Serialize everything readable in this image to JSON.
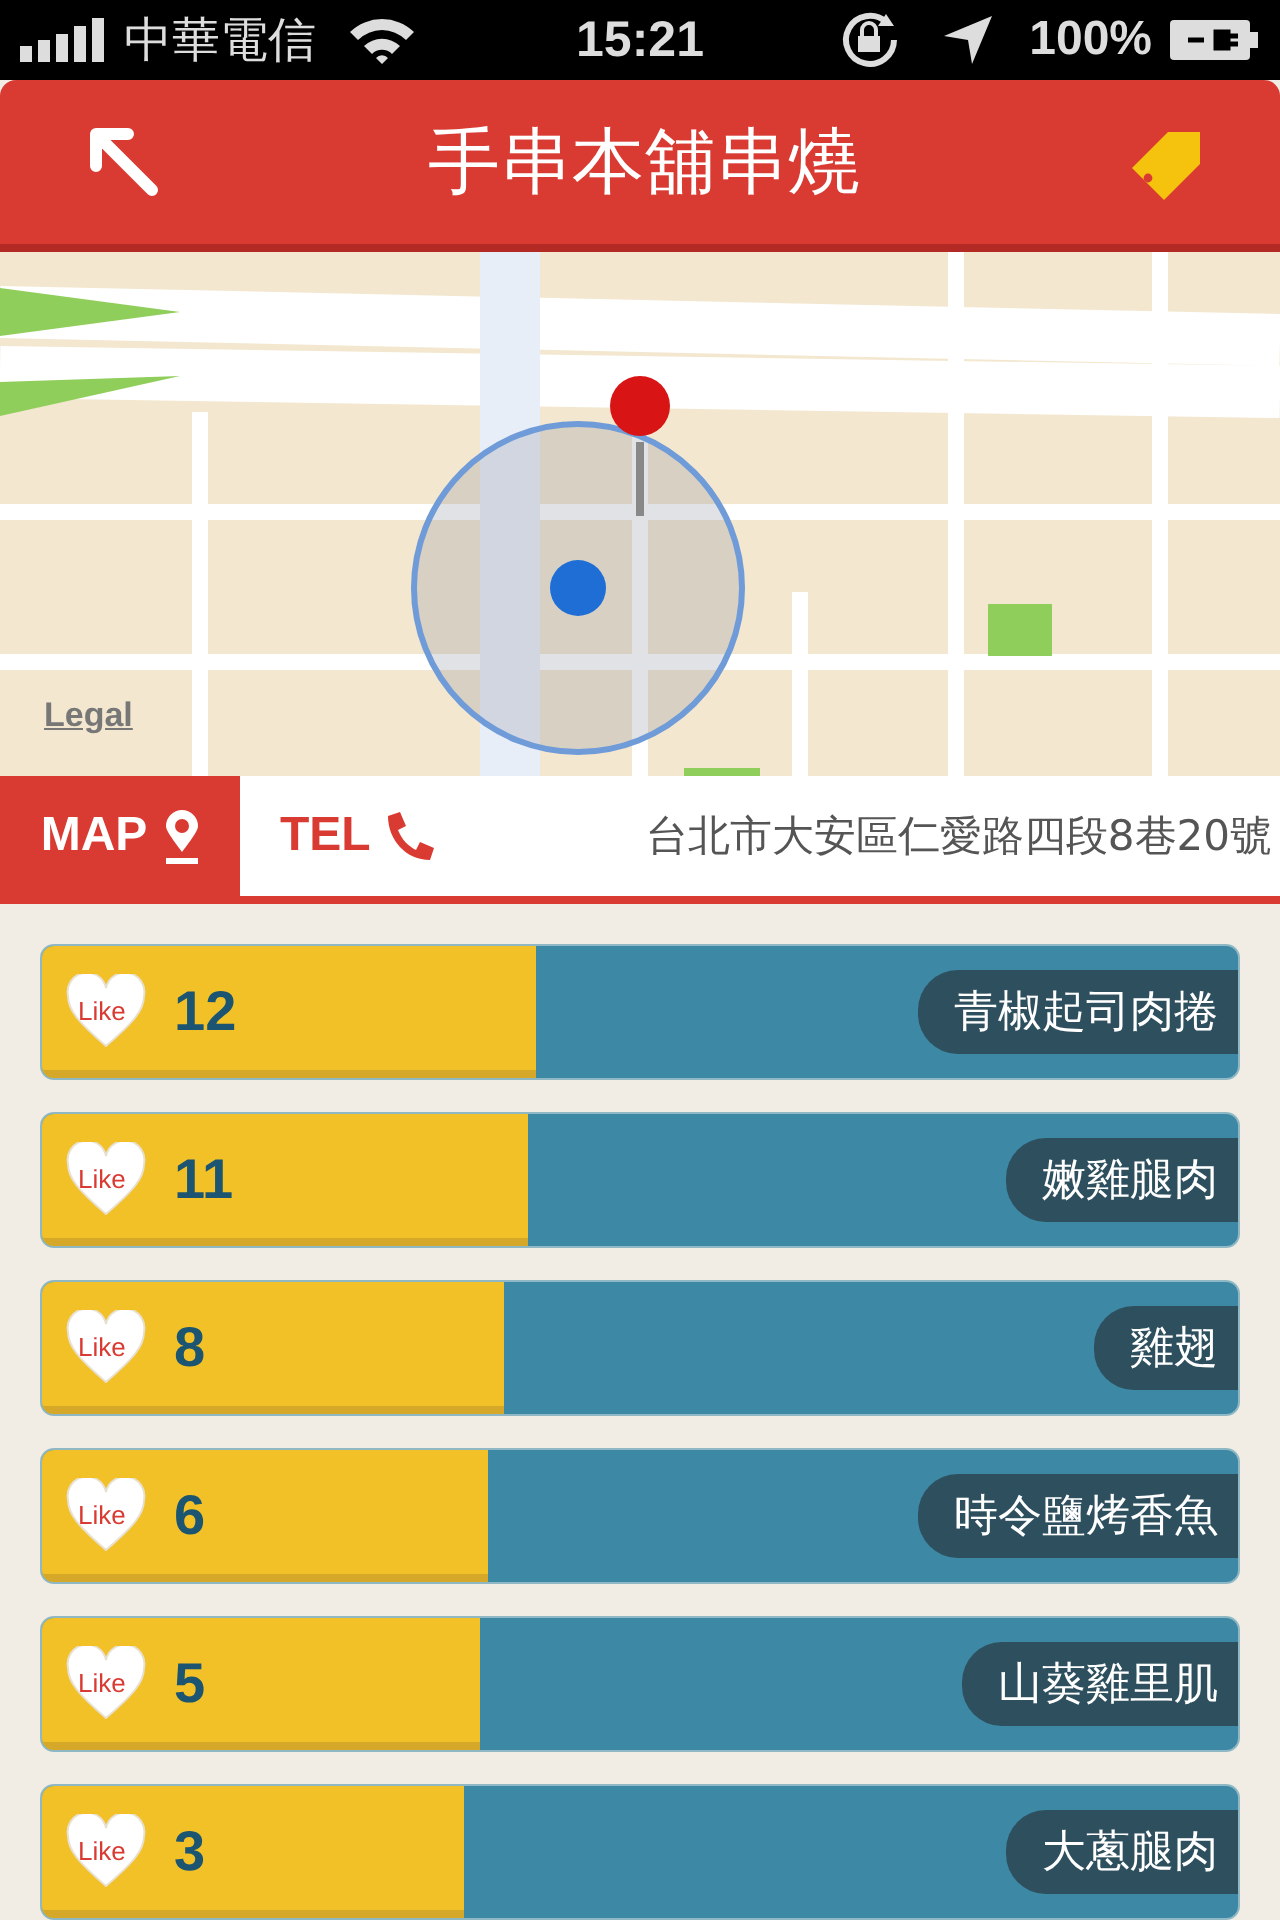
{
  "status_bar": {
    "carrier": "中華電信",
    "time": "15:21",
    "battery": "100%"
  },
  "header": {
    "title": "手串本舖串燒"
  },
  "map": {
    "legal": "Legal"
  },
  "info_bar": {
    "map_button": "MAP",
    "tel_button": "TEL",
    "address": "台北市大安區仁愛路四段8巷20號"
  },
  "items": [
    {
      "like": "Like",
      "count": "12",
      "name": "青椒起司肉捲",
      "level": 0.413
    },
    {
      "like": "Like",
      "count": "11",
      "name": "嫩雞腿肉",
      "level": 0.407
    },
    {
      "like": "Like",
      "count": "8",
      "name": "雞翅",
      "level": 0.387
    },
    {
      "like": "Like",
      "count": "6",
      "name": "時令鹽烤香魚",
      "level": 0.373
    },
    {
      "like": "Like",
      "count": "5",
      "name": "山葵雞里肌",
      "level": 0.367
    },
    {
      "like": "Like",
      "count": "3",
      "name": "大蔥腿肉",
      "level": 0.353
    }
  ]
}
